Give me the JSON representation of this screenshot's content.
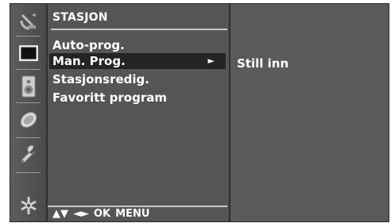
{
  "menu": {
    "title": "STASJON",
    "items": [
      {
        "label": "Auto-prog.",
        "selected": false
      },
      {
        "label": "Man. Prog.",
        "selected": true
      },
      {
        "label": "Stasjonsredig.",
        "selected": false
      },
      {
        "label": "Favoritt program",
        "selected": false
      }
    ],
    "selected_arrow": "►"
  },
  "submenu": {
    "item": "Still inn"
  },
  "nav": {
    "updown": "▲▼",
    "leftright": "◄►",
    "ok": "OK",
    "menu": "MENU"
  },
  "sidebar": {
    "icons": [
      "antenna-icon",
      "picture-icon",
      "speaker-icon",
      "clock-icon",
      "wrench-icon",
      "input-plug-icon"
    ]
  },
  "colors": {
    "panel": "#555555",
    "selected_bg": "#242424",
    "text": "#ffffff"
  }
}
